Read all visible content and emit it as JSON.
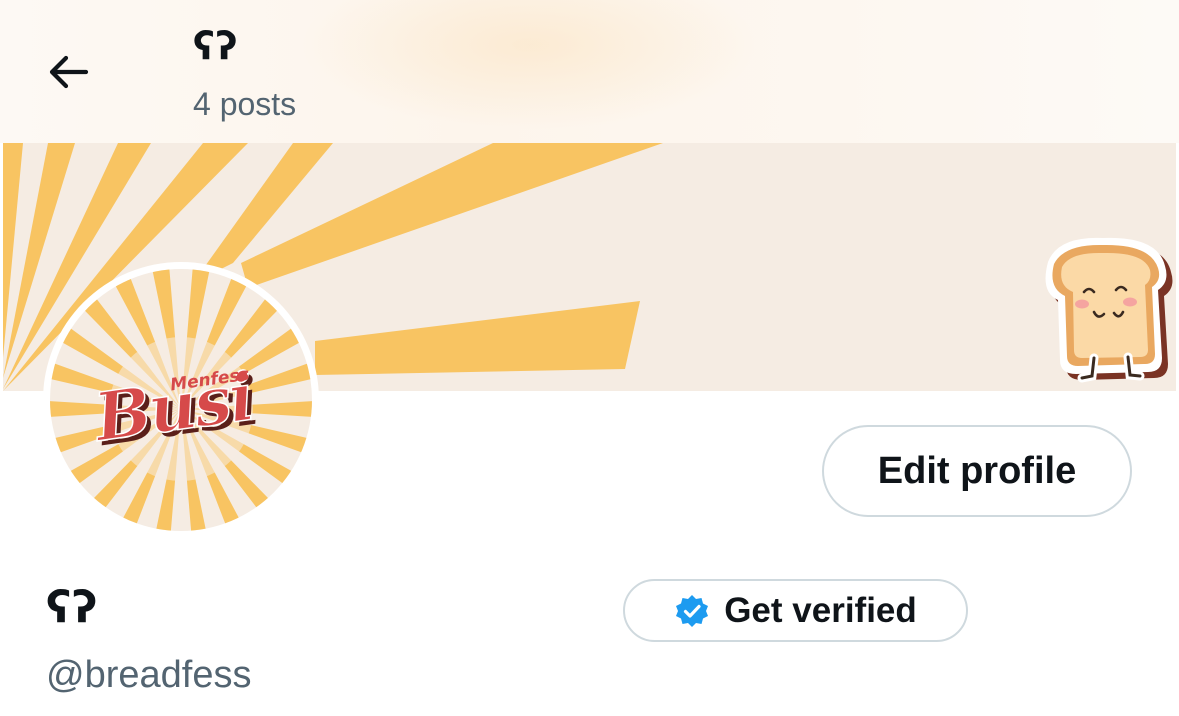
{
  "header": {
    "title": "ʕʔ",
    "posts_count": "4 posts"
  },
  "avatar": {
    "logo_text_small": "Menfess",
    "logo_text_large": "Busi"
  },
  "actions": {
    "edit_profile_label": "Edit profile",
    "get_verified_label": "Get verified"
  },
  "profile": {
    "display_name": "ʕʔ",
    "handle": "@breadfess"
  },
  "colors": {
    "banner_bg": "#f5ece3",
    "ray": "#f8c462",
    "verified_blue": "#1d9bf0",
    "logo_red": "#d64a4a",
    "muted_text": "#536471",
    "border": "#cfd9de"
  },
  "icons": {
    "back": "arrow-left-icon",
    "verified": "verified-badge-icon",
    "banner_sticker": "toast-sticker-icon"
  }
}
